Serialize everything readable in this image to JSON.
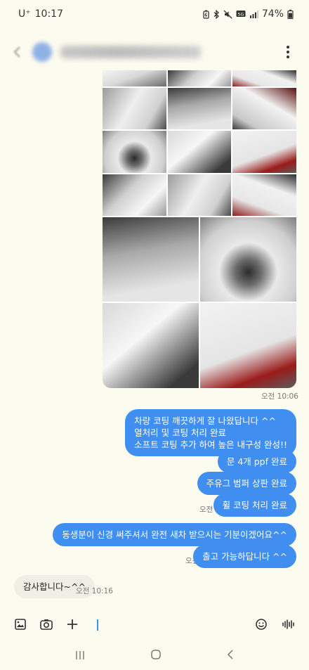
{
  "status_bar": {
    "carrier": "U⁺",
    "time": "10:17",
    "battery_percent": "74%",
    "icons": [
      "battery-saver-icon",
      "bluetooth-icon",
      "mute-icon",
      "lte-icon",
      "signal-icon",
      "battery-icon"
    ]
  },
  "header": {
    "back_icon": "back-arrow-icon",
    "contact_name_blurred": "",
    "more_icon": "more-vert-icon"
  },
  "photos": {
    "count": 9,
    "timestamp": "오전 10:06"
  },
  "messages": {
    "m1": "차량 코팅 깨끗하게 잘 나왔답니다 ^^\n열처리 및 코팅 처리 완료\n소프트 코팅 추가 하여 높은 내구성 완성!!",
    "m2": "문 4개 ppf 완료",
    "m3": "주유그 범퍼 상판 완료",
    "ts_1007": "오전 10:07",
    "m4": "휠 코팅 처리 완료",
    "m5": "동생분이 신경 써주셔서 완전 새차 받으시는 기분이겠어요^^",
    "ts_1008": "오전 10:08",
    "m6": "출고 가능하답니다 ^^",
    "m7": "감사합니다~^^",
    "ts_1016": "오전 10:16"
  },
  "composer": {
    "icons": [
      "gallery-icon",
      "camera-icon",
      "add-icon",
      "emoji-icon",
      "voice-icon"
    ],
    "input_value": ""
  },
  "nav": {
    "icons": [
      "recents-icon",
      "home-icon",
      "back-icon"
    ]
  },
  "colors": {
    "background": "#fcfbef",
    "outgoing_bubble": "#3f8ef0",
    "incoming_bubble": "#f0efe6"
  }
}
